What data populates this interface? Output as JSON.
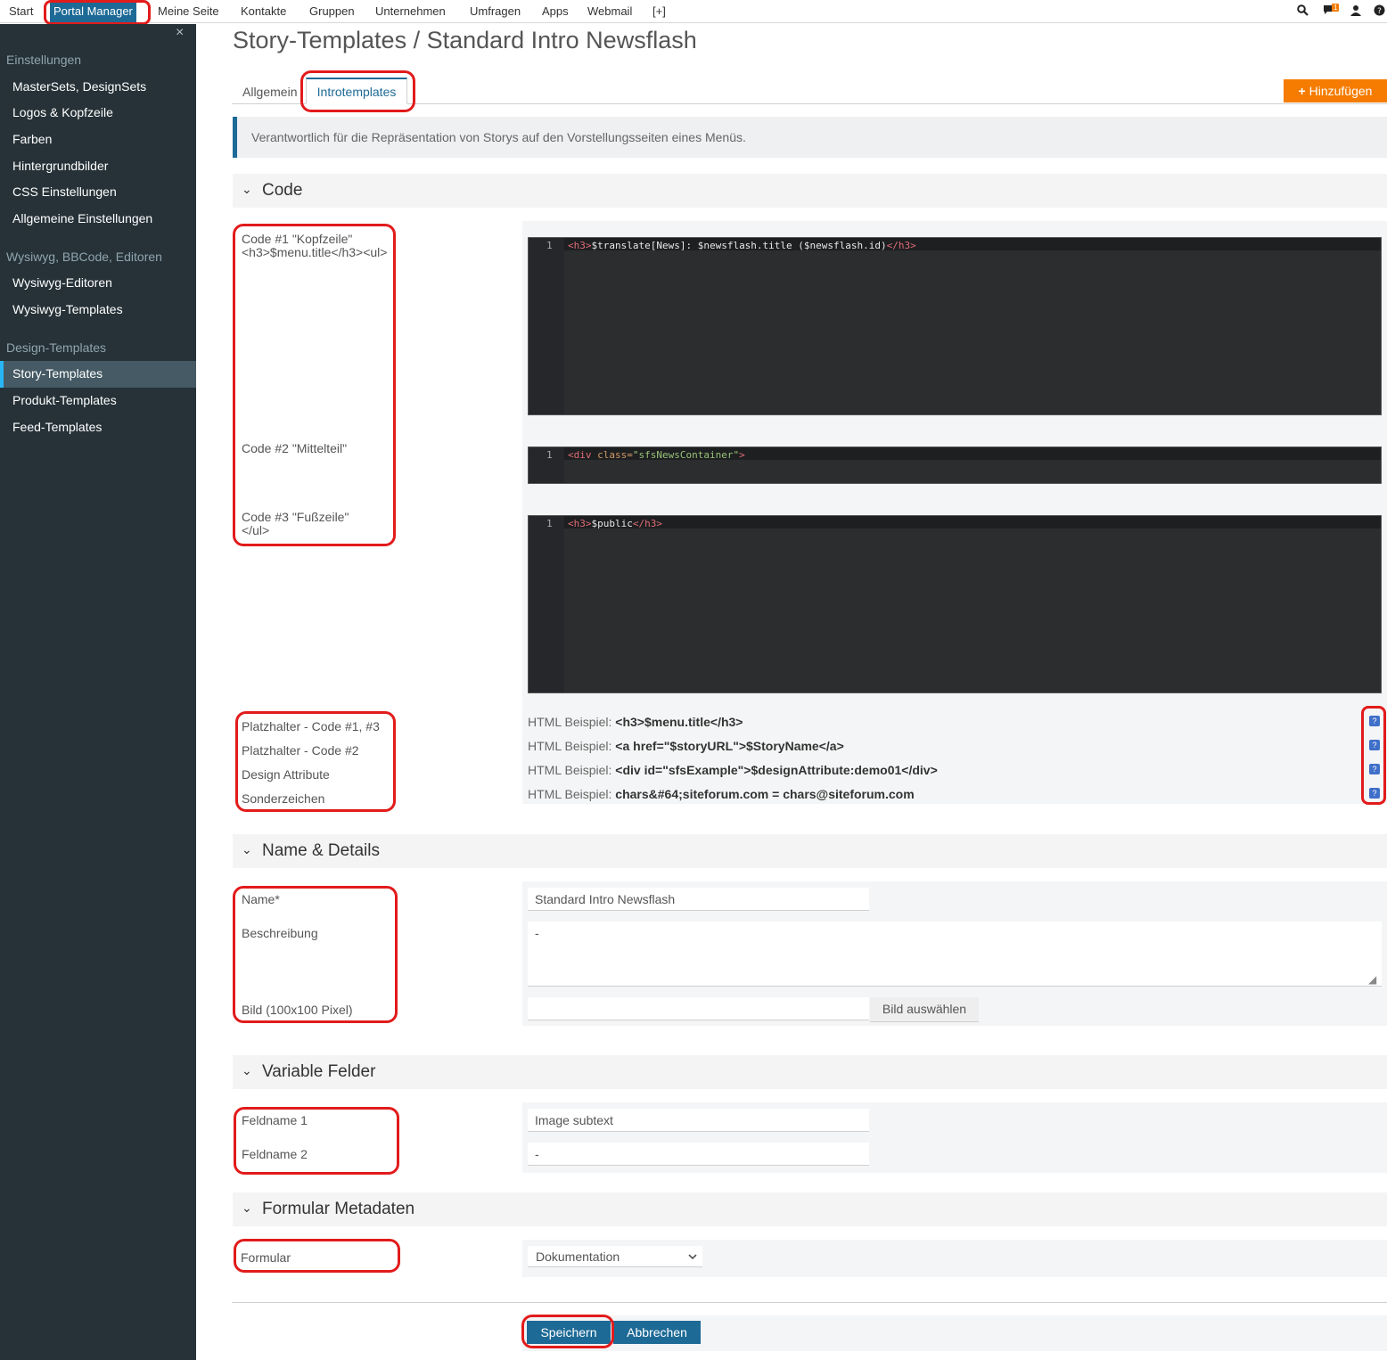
{
  "nav": {
    "items": [
      "Start",
      "Portal Manager",
      "Meine Seite",
      "Kontakte",
      "Gruppen",
      "Unternehmen",
      "Umfragen",
      "Apps",
      "Webmail",
      "[+]"
    ],
    "notification_count": "1"
  },
  "sidebar": {
    "close": "×",
    "group1": "Einstellungen",
    "group1_items": [
      "MasterSets, DesignSets",
      "Logos & Kopfzeile",
      "Farben",
      "Hintergrundbilder",
      "CSS Einstellungen",
      "Allgemeine Einstellungen"
    ],
    "group2": "Wysiwyg, BBCode, Editoren",
    "group2_items": [
      "Wysiwyg-Editoren",
      "Wysiwyg-Templates"
    ],
    "group3": "Design-Templates",
    "group3_items": [
      "Story-Templates",
      "Produkt-Templates",
      "Feed-Templates"
    ]
  },
  "page": {
    "title": "Story-Templates / Standard Intro Newsflash",
    "tabs": [
      "Allgemein",
      "Introtemplates"
    ],
    "add_button": "Hinzufügen",
    "info": "Verantwortlich für die Repräsentation von Storys auf den Vorstellungsseiten eines Menüs."
  },
  "code_section": {
    "title": "Code",
    "label1": "Code #1 \"Kopfzeile\"",
    "label1_sub": "<h3>$menu.title</h3><ul>",
    "label2": "Code #2 \"Mittelteil\"",
    "label3": "Code #3 \"Fußzeile\"",
    "label3_sub": "</ul>",
    "editor1": {
      "line": "1",
      "open": "<h3>",
      "text": "$translate[News]: $newsflash.title ($newsflash.id)",
      "close": "</h3>"
    },
    "editor2": {
      "line": "1",
      "tag": "<div",
      "attr": " class=",
      "value": "\"sfsNewsContainer\"",
      "end": ">"
    },
    "editor3": {
      "line": "1",
      "open": "<h3>",
      "text": "$public",
      "close": "</h3>"
    },
    "placeholders": [
      {
        "label": "Platzhalter - Code #1, #3",
        "prefix": "HTML Beispiel:",
        "example": "<h3>$menu.title</h3>"
      },
      {
        "label": "Platzhalter - Code #2",
        "prefix": "HTML Beispiel:",
        "example": "<a href=\"$storyURL\">$StoryName</a>"
      },
      {
        "label": "Design Attribute",
        "prefix": "HTML Beispiel:",
        "example": "<div id=\"sfsExample\">$designAttribute:demo01</div>"
      },
      {
        "label": "Sonderzeichen",
        "prefix": "HTML Beispiel:",
        "example": "chars&#64;siteforum.com = chars@siteforum.com"
      }
    ],
    "help": "?"
  },
  "details_section": {
    "title": "Name & Details",
    "name_label": "Name*",
    "name_value": "Standard Intro Newsflash",
    "desc_label": "Beschreibung",
    "desc_value": "-",
    "image_label": "Bild (100x100 Pixel)",
    "image_button": "Bild auswählen"
  },
  "variable_section": {
    "title": "Variable Felder",
    "field1_label": "Feldname 1",
    "field1_value": "Image subtext",
    "field2_label": "Feldname 2",
    "field2_value": "-"
  },
  "form_section": {
    "title": "Formular Metadaten",
    "form_label": "Formular",
    "form_value": "Dokumentation"
  },
  "actions": {
    "save": "Speichern",
    "cancel": "Abbrechen"
  }
}
